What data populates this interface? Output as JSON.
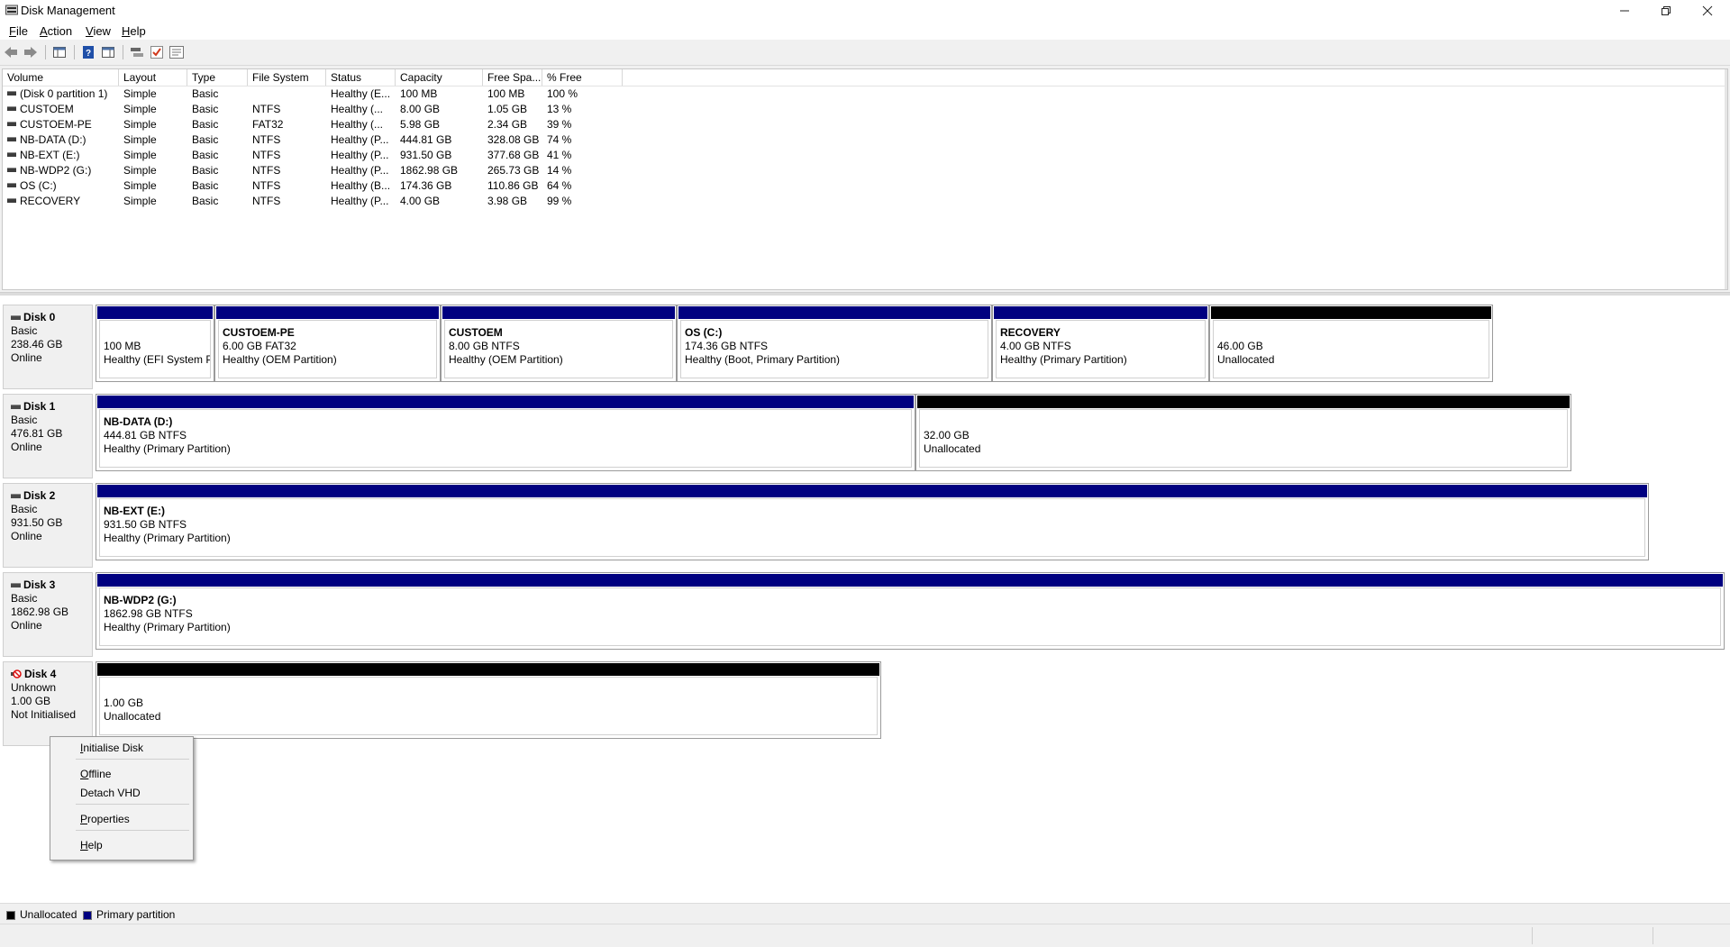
{
  "window": {
    "title": "Disk Management"
  },
  "menu": [
    {
      "label": "File",
      "key": "F"
    },
    {
      "label": "Action",
      "key": "A"
    },
    {
      "label": "View",
      "key": "V"
    },
    {
      "label": "Help",
      "key": "H"
    }
  ],
  "toolbar": [
    "back-icon",
    "forward-icon",
    "console-tree-icon",
    "help-icon",
    "show-pane-icon",
    "rescan-icon",
    "checkmark-icon",
    "properties-icon"
  ],
  "volumes": {
    "columns": [
      "Volume",
      "Layout",
      "Type",
      "File System",
      "Status",
      "Capacity",
      "Free Spa...",
      "% Free"
    ],
    "rows": [
      [
        "(Disk 0 partition 1)",
        "Simple",
        "Basic",
        "",
        "Healthy (E...",
        "100 MB",
        "100 MB",
        "100 %"
      ],
      [
        "CUSTOEM",
        "Simple",
        "Basic",
        "NTFS",
        "Healthy (...",
        "8.00 GB",
        "1.05 GB",
        "13 %"
      ],
      [
        "CUSTOEM-PE",
        "Simple",
        "Basic",
        "FAT32",
        "Healthy (...",
        "5.98 GB",
        "2.34 GB",
        "39 %"
      ],
      [
        "NB-DATA (D:)",
        "Simple",
        "Basic",
        "NTFS",
        "Healthy (P...",
        "444.81 GB",
        "328.08 GB",
        "74 %"
      ],
      [
        "NB-EXT (E:)",
        "Simple",
        "Basic",
        "NTFS",
        "Healthy (P...",
        "931.50 GB",
        "377.68 GB",
        "41 %"
      ],
      [
        "NB-WDP2 (G:)",
        "Simple",
        "Basic",
        "NTFS",
        "Healthy (P...",
        "1862.98 GB",
        "265.73 GB",
        "14 %"
      ],
      [
        "OS (C:)",
        "Simple",
        "Basic",
        "NTFS",
        "Healthy (B...",
        "174.36 GB",
        "110.86 GB",
        "64 %"
      ],
      [
        "RECOVERY",
        "Simple",
        "Basic",
        "NTFS",
        "Healthy (P...",
        "4.00 GB",
        "3.98 GB",
        "99 %"
      ]
    ]
  },
  "disks": [
    {
      "name": "Disk 0",
      "type": "Basic",
      "size": "238.46 GB",
      "status": "Online",
      "icon": "disk-icon",
      "partitions": [
        {
          "name": "",
          "size": "100 MB",
          "status": "Healthy (EFI System Pa",
          "kind": "primary"
        },
        {
          "name": "CUSTOEM-PE",
          "size": "6.00 GB FAT32",
          "status": "Healthy (OEM Partition)",
          "kind": "primary"
        },
        {
          "name": "CUSTOEM",
          "size": "8.00 GB NTFS",
          "status": "Healthy (OEM Partition)",
          "kind": "primary"
        },
        {
          "name": "OS  (C:)",
          "size": "174.36 GB NTFS",
          "status": "Healthy (Boot, Primary Partition)",
          "kind": "primary"
        },
        {
          "name": "RECOVERY",
          "size": "4.00 GB NTFS",
          "status": "Healthy (Primary Partition)",
          "kind": "primary"
        },
        {
          "name": "",
          "size": "46.00 GB",
          "status": "Unallocated",
          "kind": "unalloc"
        }
      ]
    },
    {
      "name": "Disk 1",
      "type": "Basic",
      "size": "476.81 GB",
      "status": "Online",
      "icon": "disk-icon",
      "partitions": [
        {
          "name": "NB-DATA  (D:)",
          "size": "444.81 GB NTFS",
          "status": "Healthy (Primary Partition)",
          "kind": "primary"
        },
        {
          "name": "",
          "size": "32.00 GB",
          "status": "Unallocated",
          "kind": "unalloc"
        }
      ]
    },
    {
      "name": "Disk 2",
      "type": "Basic",
      "size": "931.50 GB",
      "status": "Online",
      "icon": "disk-icon",
      "partitions": [
        {
          "name": "NB-EXT  (E:)",
          "size": "931.50 GB NTFS",
          "status": "Healthy (Primary Partition)",
          "kind": "primary"
        }
      ]
    },
    {
      "name": "Disk 3",
      "type": "Basic",
      "size": "1862.98 GB",
      "status": "Online",
      "icon": "disk-icon",
      "partitions": [
        {
          "name": "NB-WDP2  (G:)",
          "size": "1862.98 GB NTFS",
          "status": "Healthy (Primary Partition)",
          "kind": "primary"
        }
      ]
    },
    {
      "name": "Disk 4",
      "type": "Unknown",
      "size": "1.00 GB",
      "status": "Not Initialised",
      "icon": "disk-error-icon",
      "partitions": [
        {
          "name": "",
          "size": "1.00 GB",
          "status": "Unallocated",
          "kind": "unalloc"
        }
      ]
    }
  ],
  "context_menu": [
    {
      "label": "Initialise Disk",
      "key": "I"
    },
    {
      "label": "Offline",
      "key": "O"
    },
    {
      "label": "Detach VHD",
      "key": ""
    },
    {
      "label": "Properties",
      "key": "P"
    },
    {
      "label": "Help",
      "key": "H"
    }
  ],
  "legend": [
    {
      "label": "Unallocated",
      "color": "#000000"
    },
    {
      "label": "Primary partition",
      "color": "#000080"
    }
  ]
}
